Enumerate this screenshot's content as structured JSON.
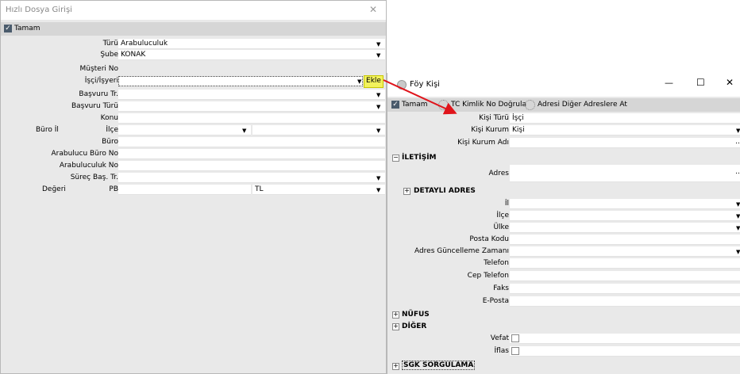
{
  "quick_entry": {
    "title": "Hızlı Dosya Girişi",
    "close_glyph": "✕",
    "ok_label": "Tamam",
    "ekle_label": "Ekle",
    "fields": {
      "turu": {
        "label": "Türü",
        "value": "Arabuluculuk"
      },
      "sube": {
        "label": "Şube",
        "value": "KONAK"
      },
      "musteri_no": {
        "label": "Müşteri No",
        "value": ""
      },
      "isci_isveren": {
        "label": "İşçi/İşyeri",
        "value": ""
      },
      "basvuru_tr": {
        "label": "Başvuru Tr.",
        "value": ""
      },
      "basvuru_turu": {
        "label": "Başvuru Türü",
        "value": ""
      },
      "konu": {
        "label": "Konu",
        "value": ""
      },
      "buro_il": {
        "label": "Büro İl",
        "value": ""
      },
      "ilce": {
        "label": "İlçe",
        "value": ""
      },
      "buro": {
        "label": "Büro",
        "value": ""
      },
      "arabulucu_buro_no": {
        "label": "Arabulucu Büro No",
        "value": ""
      },
      "arabuluculuk_no": {
        "label": "Arabuluculuk No",
        "value": ""
      },
      "surec_bas_tr": {
        "label": "Süreç Baş. Tr.",
        "value": ""
      },
      "degeri": {
        "label": "Değeri",
        "value": ""
      },
      "pb": {
        "label": "PB",
        "value": "TL"
      }
    }
  },
  "foy_kisi": {
    "title": "Föy Kişi",
    "minimize": "—",
    "maximize": "☐",
    "close": "✕",
    "toolbar": {
      "ok_label": "Tamam",
      "tc_label": "TC Kimlik No Doğrula",
      "adres_label": "Adresi Diğer Adreslere At"
    },
    "fields": {
      "kisi_turu": {
        "label": "Kişi Türü",
        "value": "İşçi"
      },
      "kisi_kurum": {
        "label": "Kişi Kurum",
        "value": "Kişi"
      },
      "kisi_kurum_adi": {
        "label": "Kişi Kurum Adı",
        "value": ""
      }
    },
    "sections": {
      "iletisim": "İLETİŞİM",
      "detayli_adres": "DETAYLI ADRES",
      "nufus": "NÜFUS",
      "diger": "DİĞER",
      "sgk": "SGK SORGULAMA"
    },
    "iletisim_fields": {
      "adres": "Adres",
      "il": "İl",
      "ilce": "İlçe",
      "ulke": "Ülke",
      "posta_kodu": "Posta Kodu",
      "adres_guncelleme": "Adres Güncelleme Zamanı",
      "telefon": "Telefon",
      "cep_telefon": "Cep Telefon",
      "faks": "Faks",
      "eposta": "E-Posta"
    },
    "diger_fields": {
      "vefat": "Vefat",
      "iflas": "İflas"
    }
  }
}
